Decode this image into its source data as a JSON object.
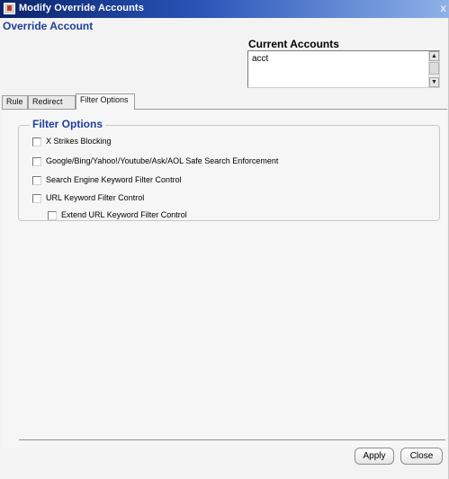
{
  "window": {
    "title": "Modify Override Accounts",
    "close_glyph": "x"
  },
  "heading": "Override Account",
  "current_accounts": {
    "label": "Current Accounts",
    "items": [
      "acct"
    ]
  },
  "tabs": [
    {
      "label": "Rule",
      "active": false
    },
    {
      "label": "Redirect",
      "active": false
    },
    {
      "label": "Filter Options",
      "active": true
    }
  ],
  "filter_options": {
    "legend": "Filter Options",
    "options": [
      {
        "label": "X Strikes Blocking",
        "checked": false
      },
      {
        "label": "Google/Bing/Yahoo!/Youtube/Ask/AOL Safe Search Enforcement",
        "checked": false
      },
      {
        "label": "Search Engine Keyword Filter Control",
        "checked": false
      },
      {
        "label": "URL Keyword Filter Control",
        "checked": false
      },
      {
        "label": "Extend URL Keyword Filter Control",
        "checked": false
      }
    ]
  },
  "buttons": {
    "apply": "Apply",
    "close": "Close"
  },
  "icons": {
    "window": "app-window-icon",
    "scroll_up": "arrow-up-icon",
    "scroll_down": "arrow-down-icon"
  },
  "colors": {
    "title_bar": "#0a246a",
    "heading_text": "#1d3f9a"
  }
}
